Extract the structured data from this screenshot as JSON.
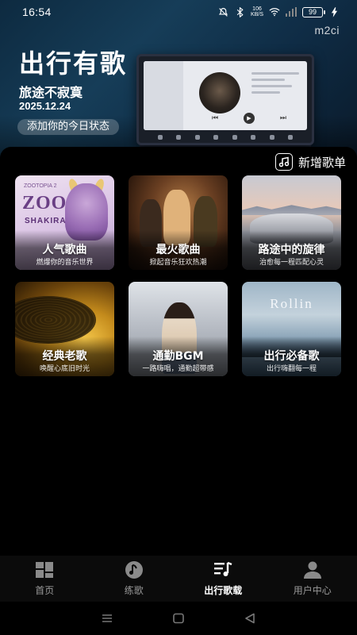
{
  "status_bar": {
    "time": "16:54",
    "net_speed_value": "106",
    "net_speed_unit": "KB/S",
    "battery": "99"
  },
  "brand": "m2ci",
  "hero": {
    "title": "出行有歌",
    "subtitle": "旅途不寂寞",
    "date": "2025.12.24",
    "status_prompt": "添加你的今日状态"
  },
  "actions": {
    "new_playlist": "新增歌单"
  },
  "playlists": [
    {
      "name": "人气歌曲",
      "desc": "燃爆你的音乐世界",
      "art": "zoo",
      "art_text": {
        "small": "ZOOTOPIA 2",
        "logo": "ZOO",
        "artist": "SHAKIRA"
      }
    },
    {
      "name": "最火歌曲",
      "desc": "掀起音乐狂欢热潮",
      "art": "party"
    },
    {
      "name": "路途中的旋律",
      "desc": "治愈每一程匹配心灵",
      "art": "road"
    },
    {
      "name": "经典老歌",
      "desc": "唤醒心底旧时光",
      "art": "vinyl"
    },
    {
      "name": "通勤BGM",
      "desc": "一路嗨唱，通勤超带感",
      "art": "bgm"
    },
    {
      "name": "出行必备歌",
      "desc": "出行嗨翻每一程",
      "art": "rollin",
      "art_text": {
        "logo": "Rollin"
      }
    }
  ],
  "bottom_nav": [
    {
      "label": "首页",
      "icon": "home-grid-icon",
      "active": false
    },
    {
      "label": "练歌",
      "icon": "practice-music-icon",
      "active": false
    },
    {
      "label": "出行歌载",
      "icon": "playlist-icon",
      "active": true
    },
    {
      "label": "用户中心",
      "icon": "user-icon",
      "active": false
    }
  ]
}
